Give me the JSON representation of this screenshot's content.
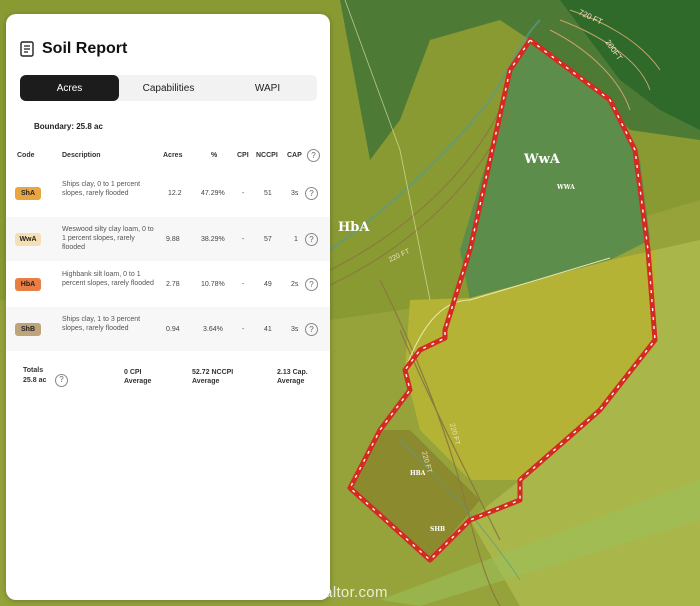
{
  "header": {
    "title": "Soil Report"
  },
  "tabs": [
    {
      "label": "Acres",
      "active": true
    },
    {
      "label": "Capabilities",
      "active": false
    },
    {
      "label": "WAPI",
      "active": false
    }
  ],
  "boundary": "Boundary: 25.8 ac",
  "table": {
    "columns": [
      "Code",
      "Description",
      "Acres",
      "%",
      "CPI",
      "NCCPI",
      "CAP"
    ],
    "rows": [
      {
        "code": "ShA",
        "color": "#e9a640",
        "description": "Ships clay, 0 to 1 percent slopes, rarely flooded",
        "acres": "12.2",
        "pct": "47.29%",
        "cpi": "-",
        "nccpi": "51",
        "cap": "3s"
      },
      {
        "code": "WwA",
        "color": "#f5dfb4",
        "description": "Weswood silty clay loam, 0 to 1 percent slopes, rarely flooded",
        "acres": "9.88",
        "pct": "38.29%",
        "cpi": "-",
        "nccpi": "57",
        "cap": "1"
      },
      {
        "code": "HbA",
        "color": "#e97e45",
        "description": "Highbank silt loam, 0 to 1 percent slopes, rarely flooded",
        "acres": "2.78",
        "pct": "10.78%",
        "cpi": "-",
        "nccpi": "49",
        "cap": "2s"
      },
      {
        "code": "ShB",
        "color": "#bda47a",
        "description": "Ships clay, 1 to 3 percent slopes, rarely flooded",
        "acres": "0.94",
        "pct": "3.64%",
        "cpi": "-",
        "nccpi": "41",
        "cap": "3s"
      }
    ]
  },
  "totals": {
    "label": "Totals",
    "acres": "25.8 ac",
    "cpi": "0 CPI",
    "cpi_sub": "Average",
    "nccpi": "52.72 NCCPI",
    "nccpi_sub": "Average",
    "cap": "2.13 Cap.",
    "cap_sub": "Average"
  },
  "map": {
    "labels": {
      "wwa_big": "WwA",
      "wwa_small": "WWA",
      "hba_big": "HbA",
      "hba_small": "HBA",
      "shb_small": "SHB"
    },
    "contours": [
      "720 FT",
      "200FT",
      "220 FT",
      "220 FT",
      "220 FT"
    ],
    "boundary_color": "#d42a20"
  },
  "watermark": "bcsrealtor.com"
}
